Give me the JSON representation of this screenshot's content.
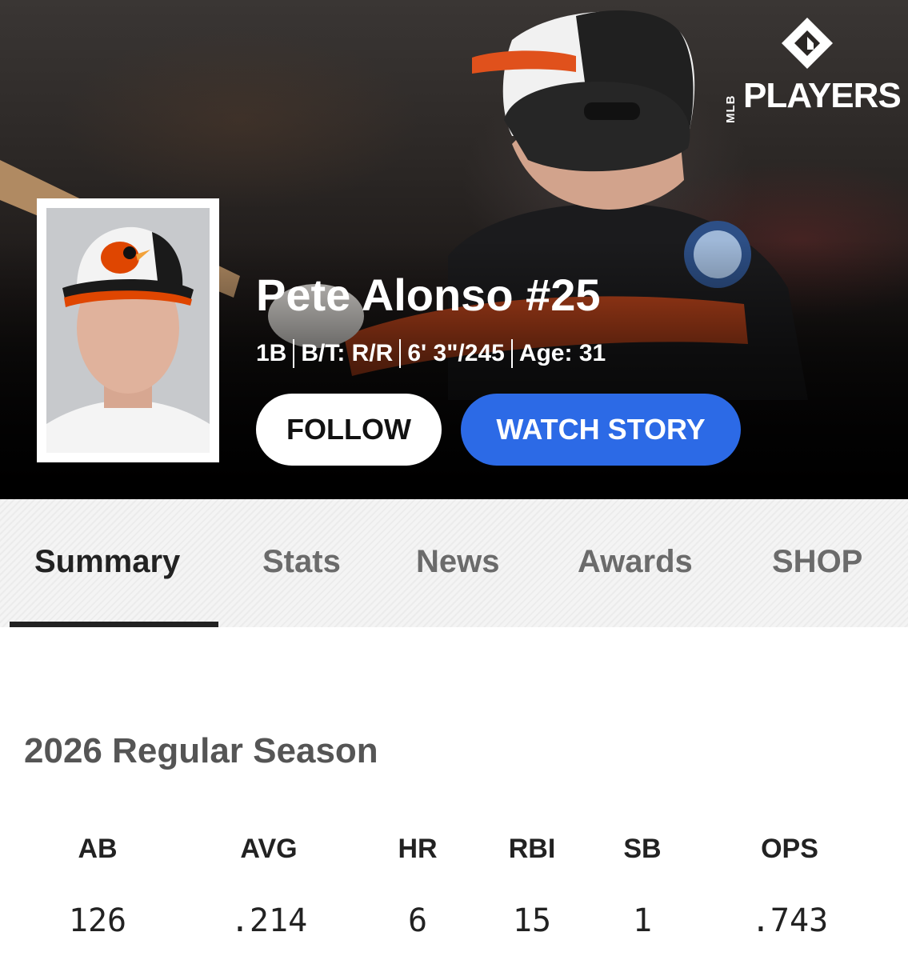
{
  "header": {
    "logo": {
      "mlb": "MLB",
      "word": "PLAYERS",
      "icon": "mlbpa-diamond-logo"
    },
    "player": {
      "name": "Pete Alonso #25",
      "position": "1B",
      "bats_throws": "B/T: R/R",
      "height_weight": "6' 3\"/245",
      "age": "Age: 31"
    },
    "actions": {
      "follow_label": "FOLLOW",
      "watch_story_label": "WATCH STORY"
    },
    "colors": {
      "story_button": "#2c6ae6",
      "orioles_orange": "#df4601",
      "orioles_black": "#000000"
    }
  },
  "tabs": [
    {
      "label": "Summary",
      "active": true
    },
    {
      "label": "Stats",
      "active": false
    },
    {
      "label": "News",
      "active": false
    },
    {
      "label": "Awards",
      "active": false
    },
    {
      "label": "SHOP",
      "active": false
    }
  ],
  "season": {
    "title": "2026 Regular Season",
    "stats": [
      {
        "label": "AB",
        "value": "126"
      },
      {
        "label": "AVG",
        "value": ".214"
      },
      {
        "label": "HR",
        "value": "6"
      },
      {
        "label": "RBI",
        "value": "15"
      },
      {
        "label": "SB",
        "value": "1"
      },
      {
        "label": "OPS",
        "value": ".743"
      }
    ]
  }
}
